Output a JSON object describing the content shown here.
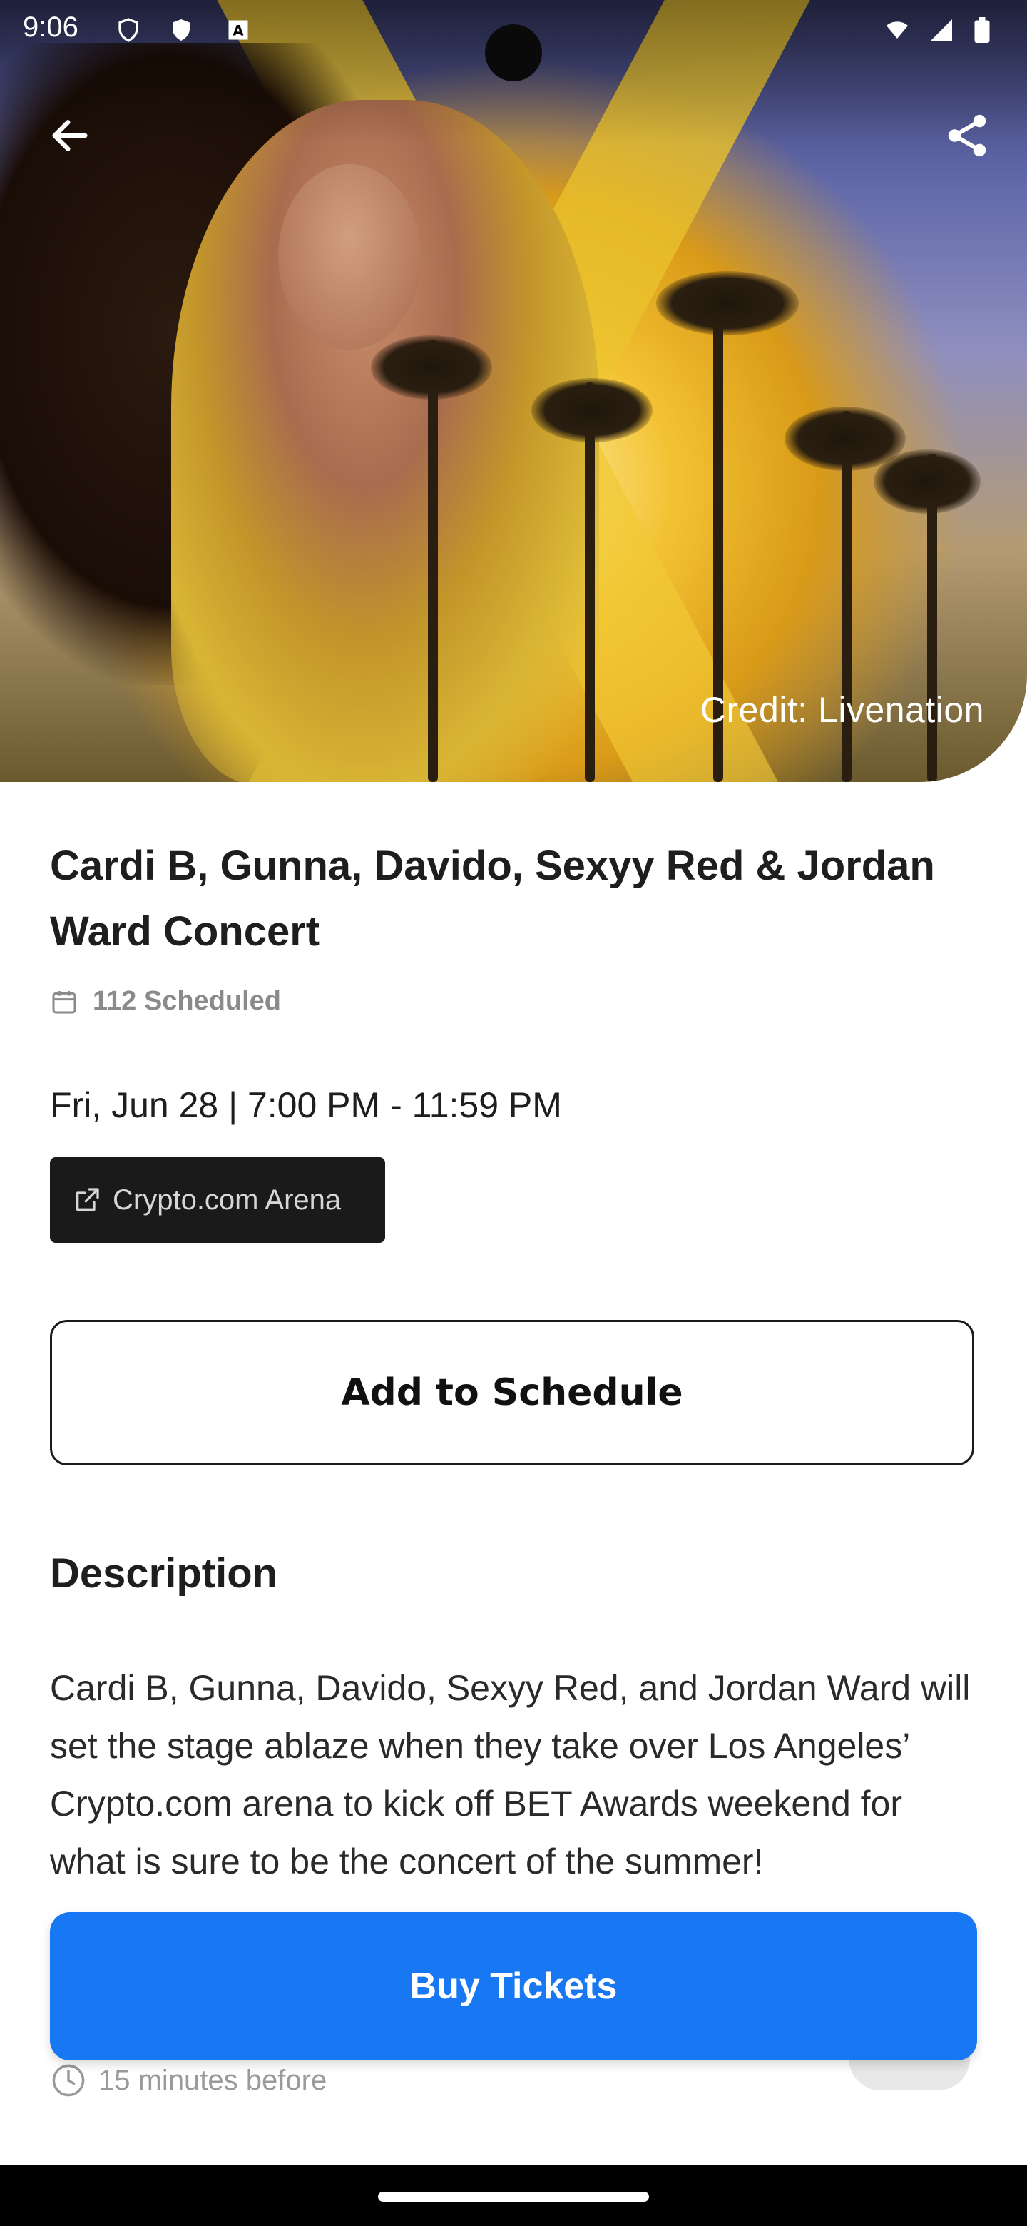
{
  "status_bar": {
    "time": "9:06"
  },
  "hero": {
    "credit": "Credit: Livenation"
  },
  "event": {
    "title": "Cardi B, Gunna, Davido, Sexyy Red & Jordan Ward Concert",
    "scheduled": "112 Scheduled",
    "datetime": "Fri, Jun 28 | 7:00 PM - 11:59 PM",
    "venue": "Crypto.com Arena"
  },
  "actions": {
    "add_to_schedule": "Add to Schedule",
    "buy_tickets": "Buy Tickets"
  },
  "description": {
    "heading": "Description",
    "text": "Cardi B, Gunna, Davido, Sexyy Red, and Jordan Ward will set the stage ablaze when they take over Los Angeles’ Crypto.com arena to kick off BET Awards weekend for what is sure to be the concert of the summer!"
  },
  "reminder": {
    "label": "15 minutes before"
  },
  "icons": {
    "back": "arrow-left-icon",
    "share": "share-icon",
    "calendar": "calendar-icon",
    "external": "external-link-icon",
    "clock": "clock-icon"
  },
  "colors": {
    "primary": "#1877f2",
    "venue_bg": "#1a1a1a"
  }
}
